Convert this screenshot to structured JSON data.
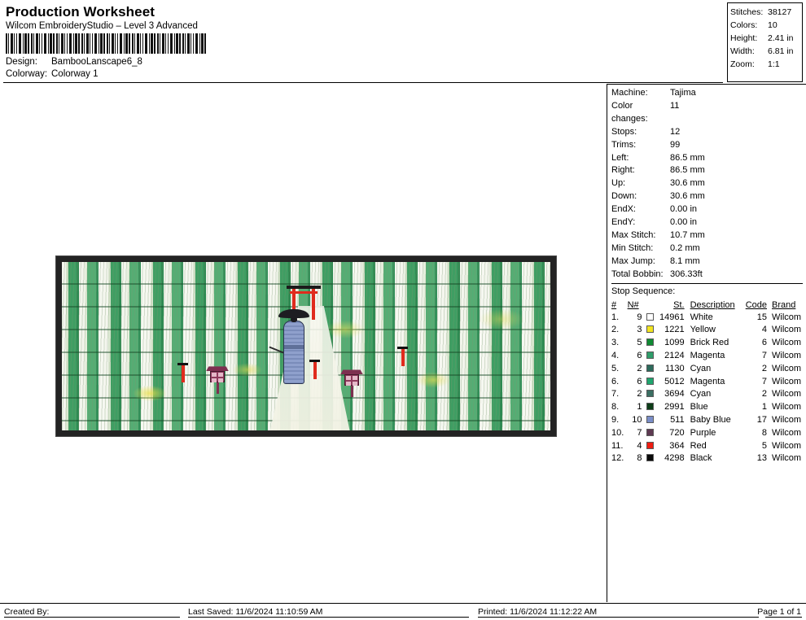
{
  "header": {
    "title": "Production Worksheet",
    "app": "Wilcom EmbroideryStudio – Level 3 Advanced",
    "barcode_name": "barcode",
    "fields": [
      {
        "key": "Design:",
        "value": "BambooLanscape6_8"
      },
      {
        "key": "Colorway:",
        "value": "Colorway 1"
      }
    ]
  },
  "summary": [
    {
      "key": "Stitches:",
      "value": "38127"
    },
    {
      "key": "Colors:",
      "value": "10"
    },
    {
      "key": "Height:",
      "value": "2.41 in"
    },
    {
      "key": "Width:",
      "value": "6.81 in"
    },
    {
      "key": "Zoom:",
      "value": "1:1"
    }
  ],
  "info": [
    {
      "key": "Machine:",
      "value": "Tajima"
    },
    {
      "key": "Color changes:",
      "value": "11"
    },
    {
      "key": "Stops:",
      "value": "12"
    },
    {
      "key": "Trims:",
      "value": "99"
    },
    {
      "key": "Left:",
      "value": "86.5 mm"
    },
    {
      "key": "Right:",
      "value": "86.5 mm"
    },
    {
      "key": "Up:",
      "value": "30.6 mm"
    },
    {
      "key": "Down:",
      "value": "30.6 mm"
    },
    {
      "key": "EndX:",
      "value": "0.00 in"
    },
    {
      "key": "EndY:",
      "value": "0.00 in"
    },
    {
      "key": "Max Stitch:",
      "value": "10.7 mm"
    },
    {
      "key": "Min Stitch:",
      "value": "0.2 mm"
    },
    {
      "key": "Max Jump:",
      "value": "8.1 mm"
    },
    {
      "key": "Total Bobbin:",
      "value": "306.33ft"
    }
  ],
  "stop_sequence": {
    "label": "Stop Sequence:",
    "columns": [
      "#",
      "N#",
      "St.",
      "Description",
      "Code",
      "Brand"
    ],
    "rows": [
      {
        "idx": "1.",
        "n": "9",
        "color": "#ffffff",
        "st": "14961",
        "desc": "White",
        "code": "15",
        "brand": "Wilcom"
      },
      {
        "idx": "2.",
        "n": "3",
        "color": "#f2e420",
        "st": "1221",
        "desc": "Yellow",
        "code": "4",
        "brand": "Wilcom"
      },
      {
        "idx": "3.",
        "n": "5",
        "color": "#0f8a33",
        "st": "1099",
        "desc": "Brick Red",
        "code": "6",
        "brand": "Wilcom"
      },
      {
        "idx": "4.",
        "n": "6",
        "color": "#2f9d6a",
        "st": "2124",
        "desc": "Magenta",
        "code": "7",
        "brand": "Wilcom"
      },
      {
        "idx": "5.",
        "n": "2",
        "color": "#2d6b5c",
        "st": "1130",
        "desc": "Cyan",
        "code": "2",
        "brand": "Wilcom"
      },
      {
        "idx": "6.",
        "n": "6",
        "color": "#1fa56e",
        "st": "5012",
        "desc": "Magenta",
        "code": "7",
        "brand": "Wilcom"
      },
      {
        "idx": "7.",
        "n": "2",
        "color": "#3b6f63",
        "st": "3694",
        "desc": "Cyan",
        "code": "2",
        "brand": "Wilcom"
      },
      {
        "idx": "8.",
        "n": "1",
        "color": "#0d3d18",
        "st": "2991",
        "desc": "Blue",
        "code": "1",
        "brand": "Wilcom"
      },
      {
        "idx": "9.",
        "n": "10",
        "color": "#7a8ec8",
        "st": "511",
        "desc": "Baby Blue",
        "code": "17",
        "brand": "Wilcom"
      },
      {
        "idx": "10.",
        "n": "7",
        "color": "#5e3a52",
        "st": "720",
        "desc": "Purple",
        "code": "8",
        "brand": "Wilcom"
      },
      {
        "idx": "11.",
        "n": "4",
        "color": "#ee1c11",
        "st": "364",
        "desc": "Red",
        "code": "5",
        "brand": "Wilcom"
      },
      {
        "idx": "12.",
        "n": "8",
        "color": "#0a0a0a",
        "st": "4298",
        "desc": "Black",
        "code": "13",
        "brand": "Wilcom"
      }
    ]
  },
  "design_preview": {
    "name": "bamboo-landscape-embroidery-preview"
  },
  "footer": {
    "created_by": "Created By:",
    "last_saved": "Last Saved: 11/6/2024 11:10:59 AM",
    "printed": "Printed: 11/6/2024 11:12:22 AM",
    "page": "Page 1 of 1"
  }
}
